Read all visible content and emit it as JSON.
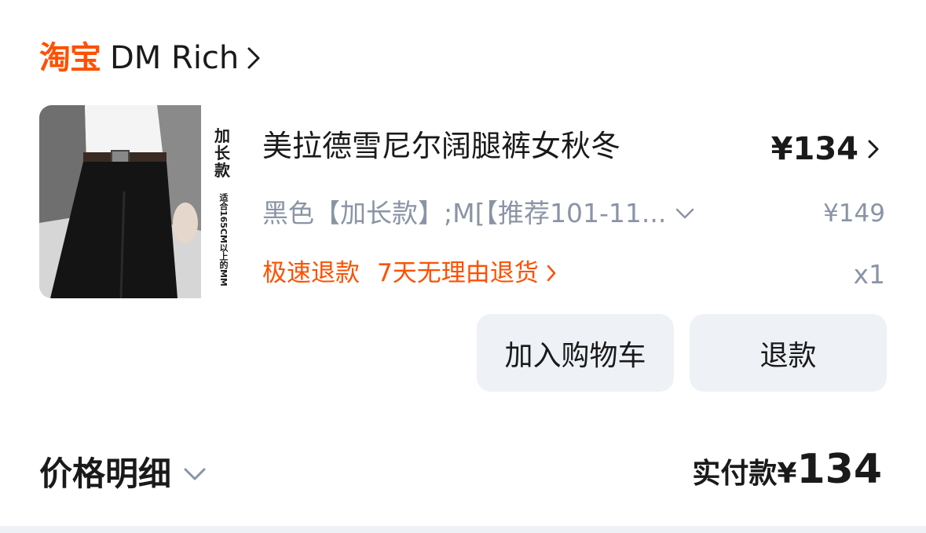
{
  "shop": {
    "logo_text": "淘宝",
    "name": "DM Rich",
    "brand_color": "#ff5000"
  },
  "product": {
    "thumbnail_badge": "加长款",
    "thumbnail_subtext": "适合165CM以上的MM",
    "title": "美拉德雪尼尔阔腿裤女秋冬",
    "price": "¥134",
    "sku": "黑色【加长款】;M[【推荐101-11...",
    "original_price": "¥149",
    "service_tags": [
      "极速退款",
      "7天无理由退货"
    ],
    "quantity": "x1"
  },
  "actions": {
    "add_to_cart": "加入购物车",
    "refund": "退款"
  },
  "footer": {
    "price_detail_label": "价格明细",
    "paid_label": "实付款",
    "paid_currency": "¥",
    "paid_amount": "134"
  },
  "colors": {
    "text_primary": "#1a1a1a",
    "text_secondary": "#8a94a6",
    "accent": "#ff5000",
    "button_bg": "#eef1f6"
  },
  "icons": {
    "shop_chevron": "chevron-right-icon",
    "price_chevron": "chevron-right-icon",
    "sku_chevron": "chevron-down-icon",
    "service_chevron": "chevron-right-icon",
    "detail_chevron": "chevron-down-icon"
  }
}
